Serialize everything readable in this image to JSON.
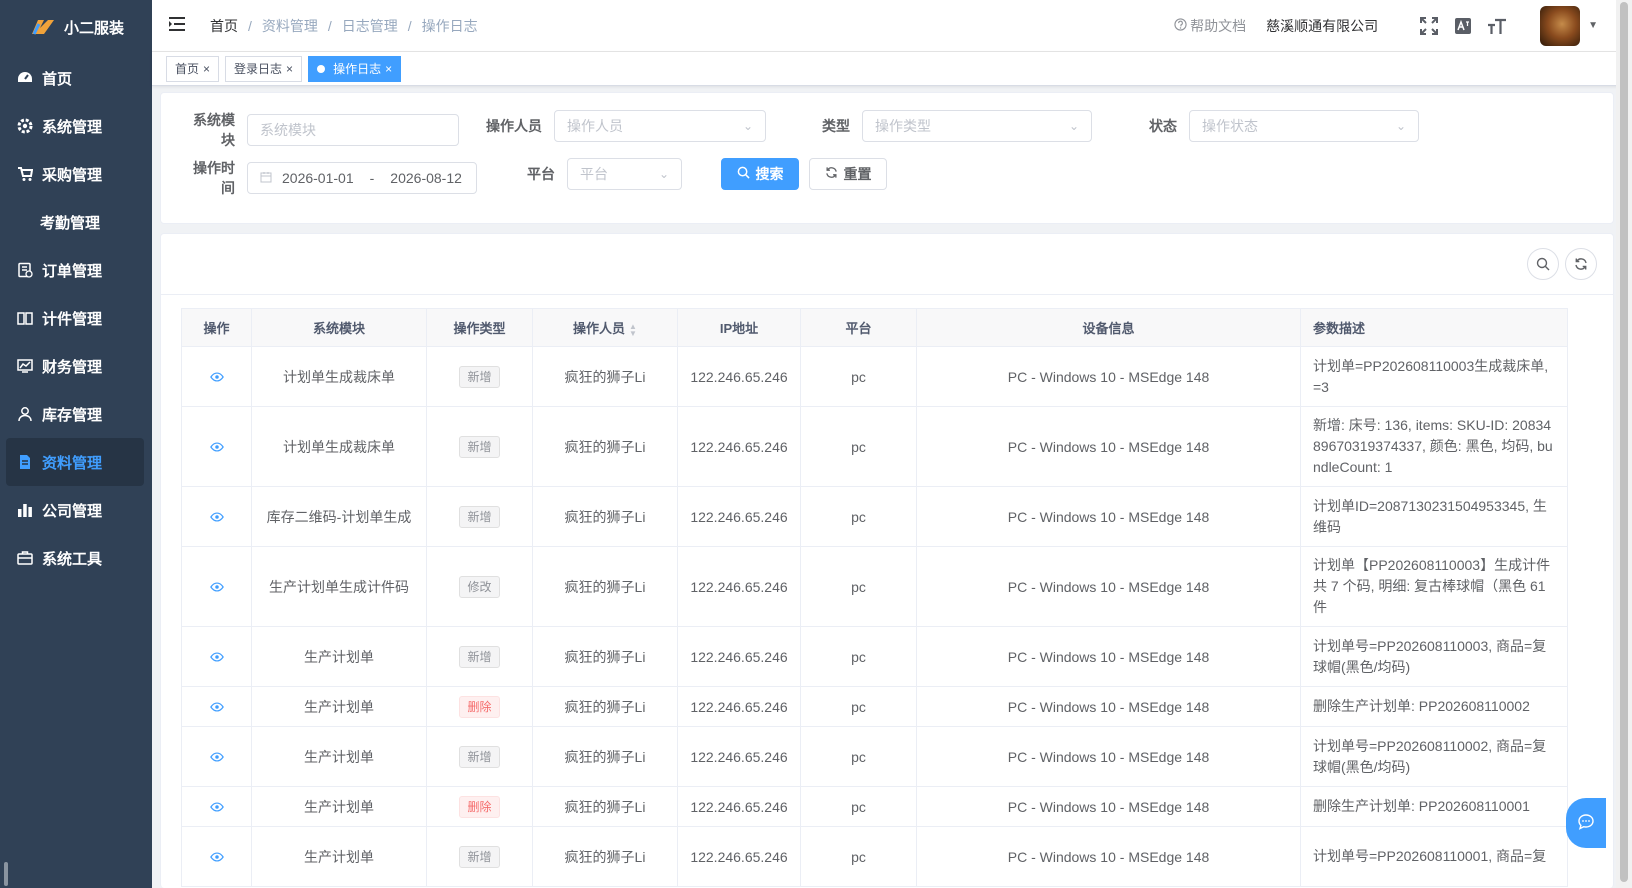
{
  "app": {
    "logo_text": "小二服装"
  },
  "sidebar": {
    "items": [
      {
        "label": "首页",
        "icon": "dashboard-icon"
      },
      {
        "label": "系统管理",
        "icon": "gear-icon"
      },
      {
        "label": "采购管理",
        "icon": "cart-icon"
      },
      {
        "label": "考勤管理",
        "icon": ""
      },
      {
        "label": "订单管理",
        "icon": "order-icon"
      },
      {
        "label": "计件管理",
        "icon": "book-icon"
      },
      {
        "label": "财务管理",
        "icon": "finance-icon"
      },
      {
        "label": "库存管理",
        "icon": "user-icon"
      },
      {
        "label": "资料管理",
        "icon": "document-icon",
        "active": true
      },
      {
        "label": "公司管理",
        "icon": "bar-chart-icon"
      },
      {
        "label": "系统工具",
        "icon": "toolbox-icon"
      }
    ]
  },
  "header": {
    "breadcrumb": [
      "首页",
      "资料管理",
      "日志管理",
      "操作日志"
    ],
    "help": "帮助文档",
    "company": "慈溪顺通有限公司"
  },
  "tags": [
    {
      "label": "首页",
      "active": false
    },
    {
      "label": "登录日志",
      "active": false
    },
    {
      "label": "操作日志",
      "active": true
    }
  ],
  "search": {
    "module_label": "系统模块",
    "module_placeholder": "系统模块",
    "operator_label": "操作人员",
    "operator_placeholder": "操作人员",
    "type_label": "类型",
    "type_placeholder": "操作类型",
    "status_label": "状态",
    "status_placeholder": "操作状态",
    "time_label": "操作时间",
    "date_start": "2026-01-01",
    "date_sep": "-",
    "date_end": "2026-08-12",
    "platform_label": "平台",
    "platform_placeholder": "平台",
    "search_btn": "搜索",
    "reset_btn": "重置"
  },
  "table": {
    "columns": [
      "操作",
      "系统模块",
      "操作类型",
      "操作人员",
      "IP地址",
      "平台",
      "设备信息",
      "参数描述"
    ],
    "rows": [
      {
        "module": "计划单生成裁床单",
        "type": "新增",
        "del": false,
        "operator": "疯狂的狮子Li",
        "ip": "122.246.65.246",
        "platform": "pc",
        "device": "PC - Windows 10 - MSEdge 148",
        "desc": "计划单=PP202608110003生成裁床单, =3"
      },
      {
        "module": "计划单生成裁床单",
        "type": "新增",
        "del": false,
        "operator": "疯狂的狮子Li",
        "ip": "122.246.65.246",
        "platform": "pc",
        "device": "PC - Windows 10 - MSEdge 148",
        "desc": "新增: 床号: 136, items: SKU-ID: 2083489670319374337, 颜色: 黑色, 均码, bundleCount: 1"
      },
      {
        "module": "库存二维码-计划单生成",
        "type": "新增",
        "del": false,
        "operator": "疯狂的狮子Li",
        "ip": "122.246.65.246",
        "platform": "pc",
        "device": "PC - Windows 10 - MSEdge 148",
        "desc": "计划单ID=2087130231504953345, 生维码"
      },
      {
        "module": "生产计划单生成计件码",
        "type": "修改",
        "del": false,
        "operator": "疯狂的狮子Li",
        "ip": "122.246.65.246",
        "platform": "pc",
        "device": "PC - Windows 10 - MSEdge 148",
        "desc": "计划单【PP202608110003】生成计件共 7 个码, 明细: 复古棒球帽（黑色 61件"
      },
      {
        "module": "生产计划单",
        "type": "新增",
        "del": false,
        "operator": "疯狂的狮子Li",
        "ip": "122.246.65.246",
        "platform": "pc",
        "device": "PC - Windows 10 - MSEdge 148",
        "desc": "计划单号=PP202608110003, 商品=复球帽(黑色/均码)"
      },
      {
        "module": "生产计划单",
        "type": "删除",
        "del": true,
        "operator": "疯狂的狮子Li",
        "ip": "122.246.65.246",
        "platform": "pc",
        "device": "PC - Windows 10 - MSEdge 148",
        "desc": "删除生产计划单: PP202608110002"
      },
      {
        "module": "生产计划单",
        "type": "新增",
        "del": false,
        "operator": "疯狂的狮子Li",
        "ip": "122.246.65.246",
        "platform": "pc",
        "device": "PC - Windows 10 - MSEdge 148",
        "desc": "计划单号=PP202608110002, 商品=复球帽(黑色/均码)"
      },
      {
        "module": "生产计划单",
        "type": "删除",
        "del": true,
        "operator": "疯狂的狮子Li",
        "ip": "122.246.65.246",
        "platform": "pc",
        "device": "PC - Windows 10 - MSEdge 148",
        "desc": "删除生产计划单: PP202608110001"
      },
      {
        "module": "生产计划单",
        "type": "新增",
        "del": false,
        "operator": "疯狂的狮子Li",
        "ip": "122.246.65.246",
        "platform": "pc",
        "device": "PC - Windows 10 - MSEdge 148",
        "desc": "计划单号=PP202608110001, 商品=复"
      }
    ]
  },
  "colors": {
    "primary": "#409eff",
    "sidebar_bg": "#304156",
    "danger": "#f56c6c"
  }
}
